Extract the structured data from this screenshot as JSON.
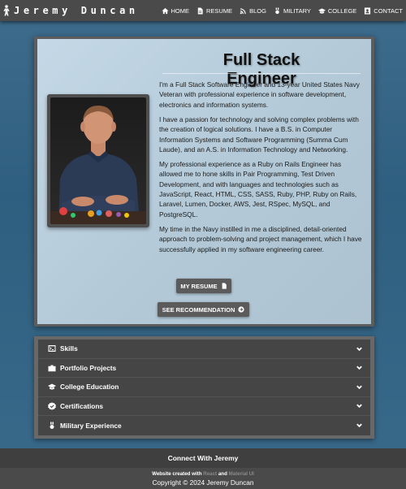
{
  "brand": {
    "name": "Jeremy Duncan",
    "icon": "soldier-icon"
  },
  "nav": {
    "items": [
      {
        "label": "HOME",
        "icon": "home-icon"
      },
      {
        "label": "RESUME",
        "icon": "document-icon"
      },
      {
        "label": "BLOG",
        "icon": "rss-icon"
      },
      {
        "label": "MILITARY",
        "icon": "medal-icon"
      },
      {
        "label": "COLLEGE",
        "icon": "graduation-cap-icon"
      },
      {
        "label": "CONTACT",
        "icon": "contact-icon"
      }
    ]
  },
  "hero": {
    "title": "Full Stack Engineer",
    "paragraphs": [
      "I'm a Full Stack Software Engineer and 13-year United States Navy Veteran with professional experience in software development, electronics and information systems.",
      "I have a passion for technology and solving complex problems with the creation of logical solutions. I have a B.S. in Computer Information Systems and Software Programming (Summa Cum Laude), and an A.S. in Information Technology and Networking.",
      "My professional experience as a Ruby on Rails Engineer has allowed me to hone skills in Pair Programming, Test Driven Development, and with languages and technologies such as JavaScript, React, HTML, CSS, SASS, Ruby, PHP, Ruby on Rails, Laravel, Lumen, Docker, AWS, Jest, RSpec, MySQL, and PostgreSQL.",
      "My time in the Navy instilled in me a disciplined, detail-oriented approach to problem-solving and project management, which I have successfully applied in my software engineering career."
    ],
    "resume_button": "MY RESUME",
    "recommendation_button": "SEE RECOMMENDATION"
  },
  "accordion": [
    {
      "label": "Skills",
      "icon": "terminal-icon"
    },
    {
      "label": "Portfolio Projects",
      "icon": "briefcase-icon"
    },
    {
      "label": "College Education",
      "icon": "graduation-cap-icon"
    },
    {
      "label": "Certifications",
      "icon": "certificate-icon"
    },
    {
      "label": "Military Experience",
      "icon": "medal-icon"
    }
  ],
  "footer": {
    "connect": "Connect With Jeremy",
    "credit_prefix": "Website created with",
    "credit_tech1": "React",
    "credit_and": "and",
    "credit_tech2": "Material UI",
    "copyright": "Copyright © 2024 Jeremy Duncan"
  },
  "colors": {
    "background": "#2f5f80",
    "navbar": "#4a4a4a",
    "card": "#c4d8e6",
    "accordion": "#454545",
    "button": "#5b5b5b"
  }
}
